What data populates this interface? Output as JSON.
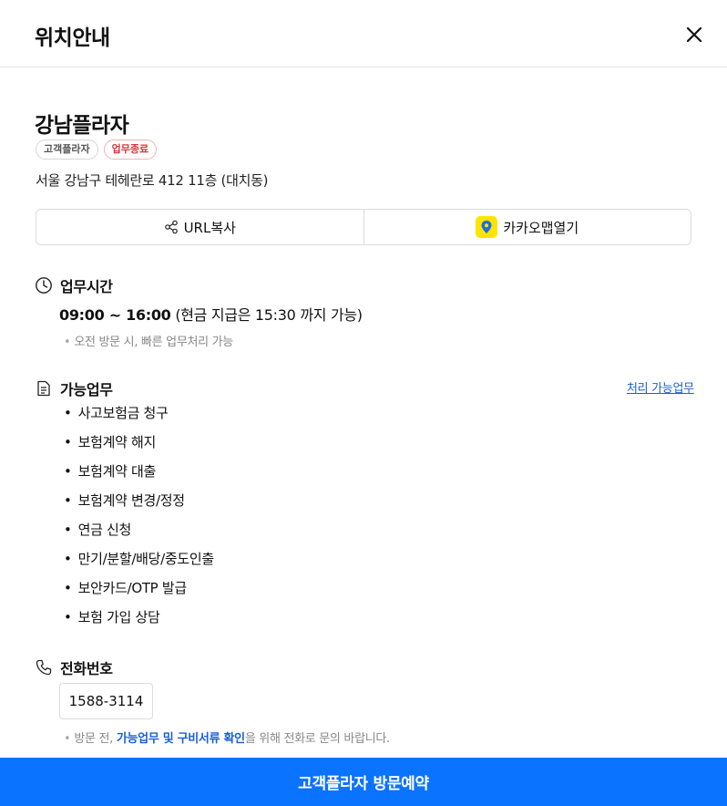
{
  "header": {
    "title": "위치안내"
  },
  "place": {
    "name": "강남플라자",
    "badges": [
      "고객플라자",
      "업무종료"
    ],
    "address": "서울 강남구 테헤란로 412 11층 (대치동)"
  },
  "actions": {
    "copy_url": "URL복사",
    "kakao_map": "카카오맵열기"
  },
  "hours": {
    "title": "업무시간",
    "time": "09:00 ~ 16:00",
    "detail": "(현금 지급은 15:30 까지 가능)",
    "note": "오전 방문 시, 빠른 업무처리 가능"
  },
  "tasks": {
    "title": "가능업무",
    "link": "처리 가능업무",
    "items": [
      "사고보험금 청구",
      "보험계약 해지",
      "보험계약 대출",
      "보험계약 변경/정정",
      "연금 신청",
      "만기/분할/배당/중도인출",
      "보안카드/OTP 발급",
      "보험 가입 상담"
    ]
  },
  "phone": {
    "title": "전화번호",
    "number": "1588-3114",
    "note_prefix": "방문 전, ",
    "note_highlight": "가능업무 및 구비서류 확인",
    "note_suffix": "을 위해 전화로 문의 바랍니다."
  },
  "cta": {
    "label": "고객플라자 방문예약"
  },
  "colors": {
    "primary": "#0a73ff",
    "link": "#1a5fd6",
    "closed": "#d9363e",
    "kakao": "#fee500"
  },
  "icons": {
    "close": "close-icon",
    "share": "share-icon",
    "kakao": "map-pin-icon",
    "clock": "clock-icon",
    "document": "document-icon",
    "phone": "phone-icon"
  }
}
